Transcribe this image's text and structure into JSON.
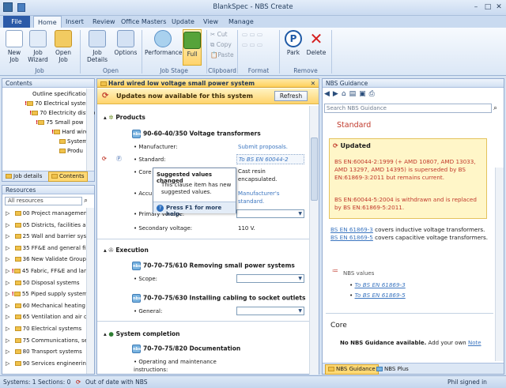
{
  "window": {
    "title": "BlankSpec - NBS Create"
  },
  "tabs": [
    "File",
    "Home",
    "Insert",
    "Review",
    "Office Masters",
    "Update",
    "View",
    "Manage"
  ],
  "ribbon": {
    "buttons": [
      "New Job",
      "Job Wizard",
      "Open Job",
      "Job Details",
      "Options",
      "Performance",
      "Full",
      "Park",
      "Delete"
    ],
    "clipboard": [
      "Cut",
      "Copy",
      "Paste"
    ],
    "groups": [
      "Job",
      "Open",
      "Job Stage",
      "Clipboard",
      "Format",
      "Remove"
    ]
  },
  "contents": {
    "title": "Contents",
    "items": [
      "Outline specification",
      "70 Electrical systems",
      "70 Electricity distrib",
      "75 Small pow",
      "Hard wire",
      "System",
      "Produ"
    ],
    "tabs": [
      "Job details",
      "Contents"
    ]
  },
  "resources": {
    "title": "Resources",
    "filter": "All resources",
    "items": [
      "00 Project management",
      "05 Districts, facilities and",
      "25 Wall and barrier syst",
      "35 FF&E and general fi",
      "36 New Validate Group",
      "45 Fabric, FF&E and landscape",
      "50 Disposal systems",
      "55 Piped supply systems",
      "60 Mechanical heating",
      "65 Ventilation and air c",
      "70 Electrical systems",
      "75 Communications, se",
      "80 Transport systems",
      "90 Services engineering"
    ]
  },
  "editor": {
    "tab_title": "Hard wired low voltage small power system",
    "banner": "Updates now available for this system",
    "refresh": "Refresh",
    "products": "Products",
    "clause1": "90-60-40/350  Voltage transformers",
    "manufacturer_label": "• Manufacturer:",
    "manufacturer_value": "Submit proposals.",
    "standard_label": "• Standard:",
    "standard_value": "To BS EN 60044-2",
    "core_label": "• Core",
    "core_value": "Cast resin encapsulated.",
    "acc_label": "• Accu",
    "acc_value": "Manufacturer's standard.",
    "primary_label": "• Primary voltage:",
    "secondary_label": "• Secondary voltage:",
    "secondary_value": "110 V.",
    "execution": "Execution",
    "clause2": "70-70-75/610  Removing small power systems",
    "scope_label": "• Scope:",
    "clause3": "70-70-75/630  Installing cabling to socket outlets",
    "general_label": "• General:",
    "completion": "System completion",
    "clause4": "70-70-75/820  Documentation",
    "ops_label": "• Operating and maintenance instructions:",
    "tooltip_title": "Suggested values changed",
    "tooltip_body": "This clause item has new suggested values.",
    "tooltip_help": "Press F1 for more help."
  },
  "guidance": {
    "title": "NBS Guidance",
    "search_placeholder": "Search NBS Guidance",
    "heading": "Standard",
    "updated": "Updated",
    "para1": "BS EN:60044-2:1999 (+ AMD 10807, AMD 13033, AMD 13297, AMD 14395) is superseded by BS EN:61869-3:2011 but remains current.",
    "para2": "BS EN:60044-5:2004 is withdrawn and is replaced by BS EN:61869-5:2011.",
    "link1": "BS EN 61869-3",
    "text1": " covers inductive voltage transformers. ",
    "link2": "BS EN 61869-5",
    "text2": " covers capacitive voltage transformers.",
    "values_label": "NBS values",
    "values": [
      "To BS EN 61869-3",
      "To BS EN 61869-5"
    ],
    "core": "Core",
    "none": "No NBS Guidance available.",
    "add": "Add your own",
    "note": "Note",
    "tabs": [
      "NBS Guidance",
      "NBS Plus"
    ]
  },
  "status": {
    "systems": "Systems: 1",
    "sections": "Sections: 0",
    "outdated": "Out of date with NBS",
    "user": "Phil signed in"
  }
}
